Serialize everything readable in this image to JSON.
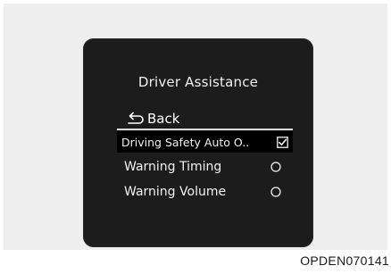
{
  "screen": {
    "title": "Driver Assistance",
    "back_label": "Back"
  },
  "menu": {
    "items": [
      {
        "label": "Driving Safety Auto O..",
        "control": "checkbox",
        "checked": true,
        "selected": true
      },
      {
        "label": "Warning Timing",
        "control": "radio",
        "checked": false,
        "selected": false
      },
      {
        "label": "Warning Volume",
        "control": "radio",
        "checked": false,
        "selected": false
      }
    ]
  },
  "caption": "OPDEN070141",
  "icons": {
    "back": "return-arrow-icon",
    "checkbox": "checkbox-checked-icon",
    "radio": "radio-empty-icon"
  },
  "colors": {
    "screen_background": "#1c1c1c",
    "text": "#f2f2f2",
    "highlight": "#000000"
  }
}
